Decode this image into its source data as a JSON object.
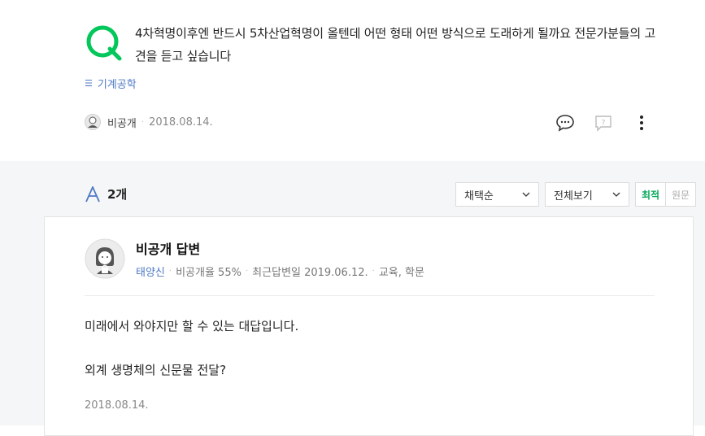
{
  "question": {
    "text": "4차혁명이후엔 반드시 5차산업혁명이 올텐데 어떤 형태 어떤 방식으로 도래하게 될까요 전문가분들의 고견을 듣고 싶습니다",
    "category_icon": "category-icon",
    "category": "기계공학",
    "author": "비공개",
    "date": "2018.08.14."
  },
  "answers_header": {
    "count": "2개",
    "sort_select": "채택순",
    "view_select": "전체보기",
    "toggle_latest": "최적",
    "toggle_original": "원문"
  },
  "answer": {
    "title": "비공개 답변",
    "meta_name": "태양신",
    "meta_rate": "비공개율 55%",
    "meta_recent": "최근답변일 2019.06.12.",
    "meta_field": "교육, 학문",
    "body_line1": "미래에서 와야지만 할 수 있는 대답입니다.",
    "body_line2": "외계 생명체의 신문물 전달?",
    "date": "2018.08.14."
  },
  "colors": {
    "q_green": "#03c75a",
    "a_blue": "#4f79c5",
    "selected_green": "#03aa5a",
    "answers_bg": "#f5f6f7"
  }
}
